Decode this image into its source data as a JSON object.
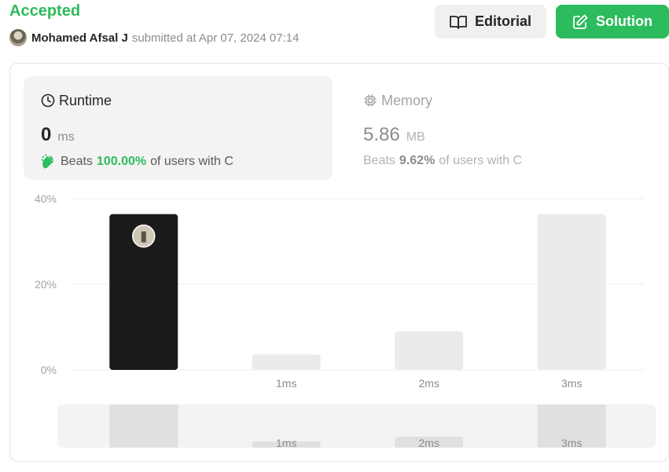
{
  "header": {
    "status": "Accepted",
    "username": "Mohamed Afsal J",
    "submitted_text": "submitted at Apr 07, 2024 07:14",
    "editorial_label": "Editorial",
    "solution_label": "Solution"
  },
  "runtime": {
    "title": "Runtime",
    "value": "0",
    "unit": "ms",
    "beats_prefix": "Beats",
    "beats_pct": "100.00%",
    "beats_suffix": "of users with C"
  },
  "memory": {
    "title": "Memory",
    "value": "5.86",
    "unit": "MB",
    "beats_prefix": "Beats",
    "beats_pct": "9.62%",
    "beats_suffix": "of users with C"
  },
  "colors": {
    "accent_green": "#2cbb5d",
    "selected_bar": "#1a1a1a",
    "bar": "#ebebeb"
  },
  "chart_data": {
    "type": "bar",
    "categories": [
      "",
      "1ms",
      "2ms",
      "3ms"
    ],
    "values": [
      36.4,
      3.6,
      9.0,
      36.4
    ],
    "selected_index": 0,
    "y_ticks": [
      "0%",
      "20%",
      "40%"
    ],
    "ylim": [
      0,
      40
    ],
    "grid": true,
    "overview": {
      "categories": [
        "",
        "1ms",
        "2ms",
        "3ms"
      ],
      "values": [
        36.4,
        3.6,
        9.0,
        36.4
      ]
    }
  }
}
